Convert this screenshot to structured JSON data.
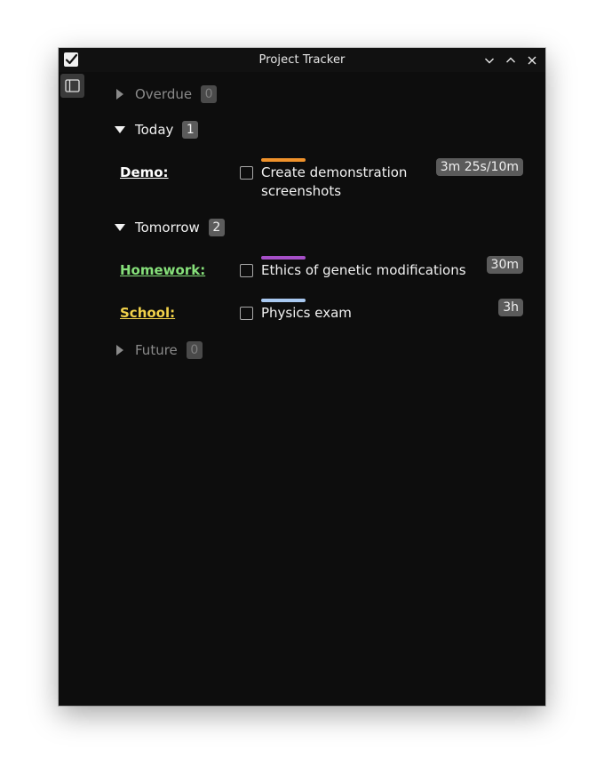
{
  "window": {
    "title": "Project Tracker"
  },
  "colors": {
    "background": "#0d0d0d",
    "demo_project": "#ffffff",
    "homework_project": "#86e07a",
    "school_project": "#f2d24a",
    "demo_strip": "#f0922b",
    "homework_strip": "#a64fc8",
    "school_strip": "#a8c8f0"
  },
  "groups": {
    "overdue": {
      "label": "Overdue",
      "count": "0"
    },
    "today": {
      "label": "Today",
      "count": "1"
    },
    "tomorrow": {
      "label": "Tomorrow",
      "count": "2"
    },
    "future": {
      "label": "Future",
      "count": "0"
    }
  },
  "tasks": {
    "demo": {
      "project": "Demo:",
      "title_line1": "Create demonstration",
      "title_line2": "screenshots",
      "time": "3m 25s/10m"
    },
    "homework": {
      "project": "Homework:",
      "title": "Ethics of genetic modifications",
      "time": "30m"
    },
    "school": {
      "project": "School:",
      "title": "Physics exam",
      "time": "3h"
    }
  }
}
